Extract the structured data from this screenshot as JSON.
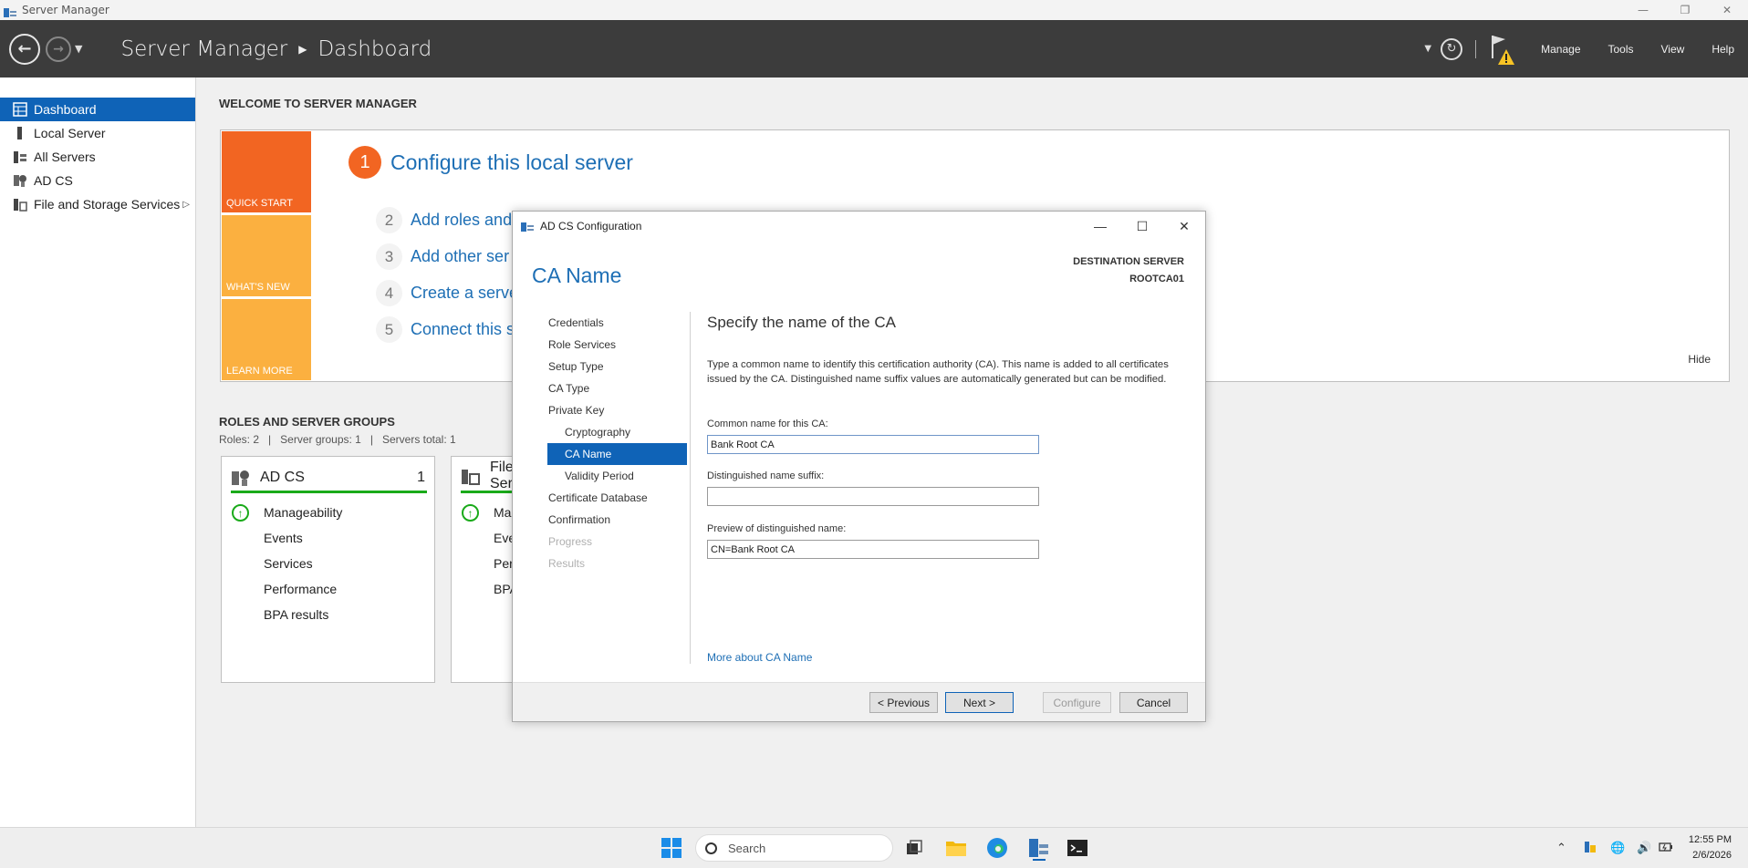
{
  "window": {
    "title": "Server Manager"
  },
  "header": {
    "breadcrumb_app": "Server Manager",
    "breadcrumb_page": "Dashboard",
    "menus": [
      "Manage",
      "Tools",
      "View",
      "Help"
    ]
  },
  "sidebar": {
    "items": [
      {
        "label": "Dashboard",
        "icon": "dashboard-icon"
      },
      {
        "label": "Local Server",
        "icon": "server-icon"
      },
      {
        "label": "All Servers",
        "icon": "servers-icon"
      },
      {
        "label": "AD CS",
        "icon": "certificate-icon"
      },
      {
        "label": "File and Storage Services",
        "icon": "storage-icon"
      }
    ]
  },
  "welcome": {
    "heading": "WELCOME TO SERVER MANAGER",
    "tiles": [
      "QUICK START",
      "WHAT'S NEW",
      "LEARN MORE"
    ],
    "steps": [
      {
        "num": "1",
        "text": "Configure this local server"
      },
      {
        "num": "2",
        "text": "Add roles and"
      },
      {
        "num": "3",
        "text": "Add other ser"
      },
      {
        "num": "4",
        "text": "Create a serve"
      },
      {
        "num": "5",
        "text": "Connect this s"
      }
    ],
    "hide": "Hide"
  },
  "roles": {
    "heading": "ROLES AND SERVER GROUPS",
    "summary": "Roles: 2   |   Server groups: 1   |   Servers total: 1",
    "cards": [
      {
        "title": "AD CS",
        "count": "1",
        "rows": [
          "Manageability",
          "Events",
          "Services",
          "Performance",
          "BPA results"
        ]
      },
      {
        "title_1": "File",
        "title_2": "Ser",
        "rows": [
          "Man",
          "Eve",
          "Perf",
          "BPA"
        ]
      }
    ]
  },
  "dialog": {
    "title": "AD CS Configuration",
    "page_title": "CA Name",
    "destination_label": "DESTINATION SERVER",
    "destination_value": "ROOTCA01",
    "nav": [
      {
        "label": "Credentials",
        "state": "normal",
        "sub": false
      },
      {
        "label": "Role Services",
        "state": "normal",
        "sub": false
      },
      {
        "label": "Setup Type",
        "state": "normal",
        "sub": false
      },
      {
        "label": "CA Type",
        "state": "normal",
        "sub": false
      },
      {
        "label": "Private Key",
        "state": "normal",
        "sub": false
      },
      {
        "label": "Cryptography",
        "state": "normal",
        "sub": true
      },
      {
        "label": "CA Name",
        "state": "active",
        "sub": true
      },
      {
        "label": "Validity Period",
        "state": "normal",
        "sub": true
      },
      {
        "label": "Certificate Database",
        "state": "normal",
        "sub": false
      },
      {
        "label": "Confirmation",
        "state": "normal",
        "sub": false
      },
      {
        "label": "Progress",
        "state": "disabled",
        "sub": false
      },
      {
        "label": "Results",
        "state": "disabled",
        "sub": false
      }
    ],
    "heading": "Specify the name of the CA",
    "description": "Type a common name to identify this certification authority (CA). This name is added to all certificates issued by the CA. Distinguished name suffix values are automatically generated but can be modified.",
    "cn_label": "Common name for this CA:",
    "cn_value": "Bank Root CA",
    "suffix_label": "Distinguished name suffix:",
    "suffix_value": "",
    "preview_label": "Preview of distinguished name:",
    "preview_value": "CN=Bank Root CA",
    "more_link": "More about CA Name",
    "buttons": {
      "previous": "< Previous",
      "next": "Next >",
      "configure": "Configure",
      "cancel": "Cancel"
    }
  },
  "taskbar": {
    "search_placeholder": "Search",
    "time": "12:55 PM",
    "date": "2/6/2026"
  },
  "colors": {
    "accent": "#0f63b7",
    "link": "#1e6fb5",
    "quick_start": "#f26522",
    "tiles": "#fbb040",
    "ok_green": "#1aaa1a"
  }
}
